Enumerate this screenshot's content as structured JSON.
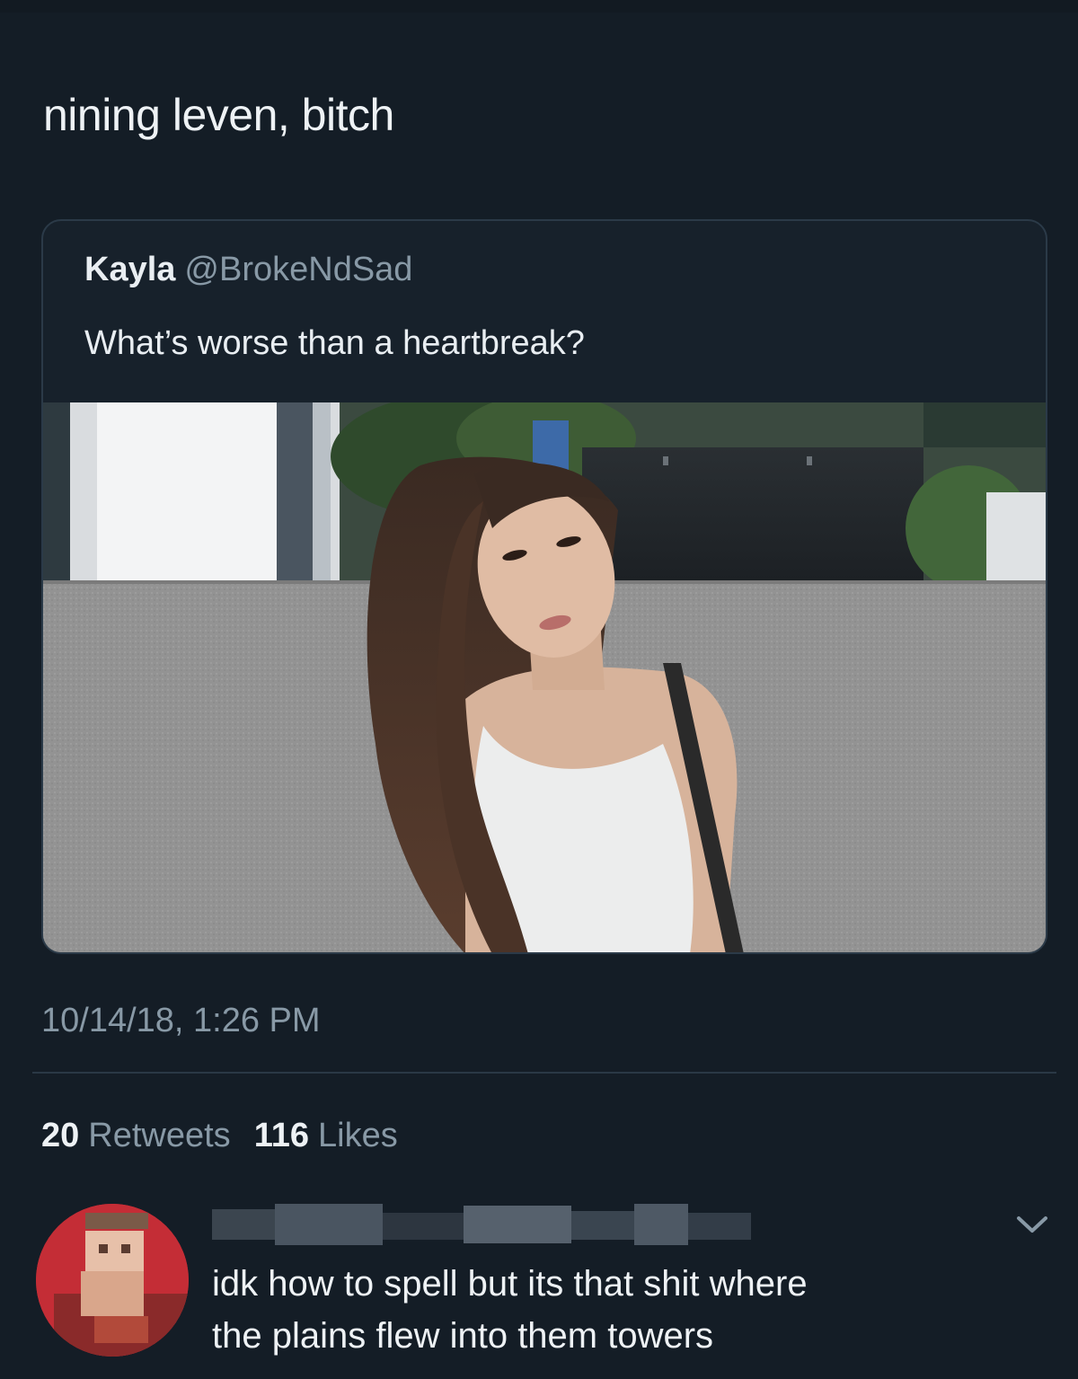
{
  "tweet": {
    "text": "nining leven, bitch",
    "quoted": {
      "name": "Kayla",
      "handle": "@BrokeNdSad",
      "text": "What’s worse than a heartbreak?"
    },
    "timestamp": "10/14/18, 1:26 PM",
    "stats": {
      "retweets_count": "20",
      "retweets_label": "Retweets",
      "likes_count": "116",
      "likes_label": "Likes"
    }
  },
  "reply": {
    "text_lines": [
      "idk how to spell but its that shit where",
      "the plains flew into them towers"
    ],
    "chevron_icon": "chevron-down-icon"
  },
  "colors": {
    "background": "#141d26",
    "secondary_text": "#8899a6",
    "primary_text": "#eef2f5",
    "card_border": "#2b3a48"
  }
}
